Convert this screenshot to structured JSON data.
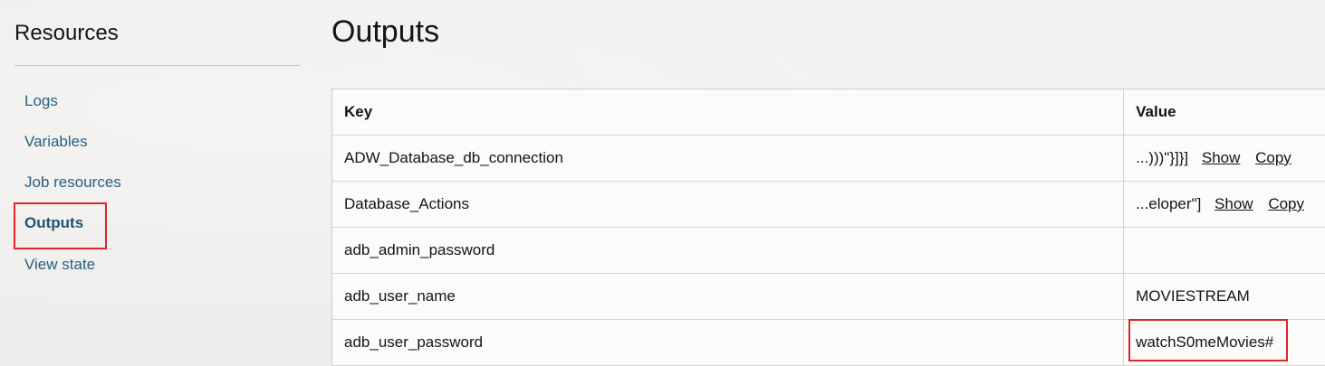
{
  "sidebar": {
    "heading": "Resources",
    "items": [
      {
        "label": "Logs"
      },
      {
        "label": "Variables"
      },
      {
        "label": "Job resources"
      },
      {
        "label": "Outputs",
        "active": true
      },
      {
        "label": "View state"
      }
    ]
  },
  "main": {
    "title": "Outputs",
    "table": {
      "headers": {
        "key": "Key",
        "value": "Value"
      },
      "rows": [
        {
          "key": "ADW_Database_db_connection",
          "value": "...)))\"}]}]",
          "show": "Show",
          "copy": "Copy"
        },
        {
          "key": "Database_Actions",
          "value": "...eloper\"]",
          "show": "Show",
          "copy": "Copy"
        },
        {
          "key": "adb_admin_password",
          "value": ""
        },
        {
          "key": "adb_user_name",
          "value": "MOVIESTREAM"
        },
        {
          "key": "adb_user_password",
          "value": "watchS0meMovies#"
        }
      ]
    }
  },
  "colors": {
    "link": "#266080",
    "highlight": "#d9262b"
  }
}
